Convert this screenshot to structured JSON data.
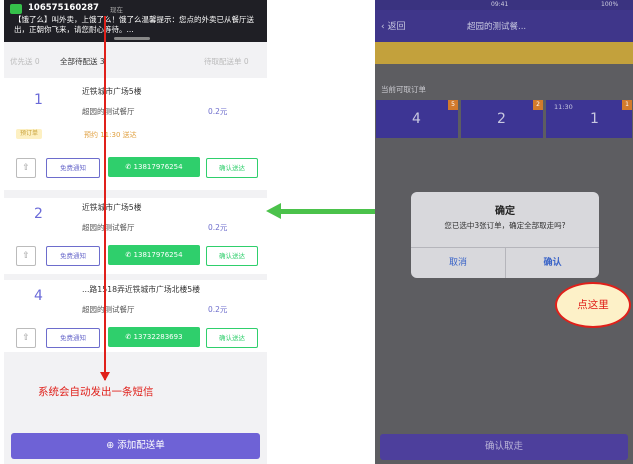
{
  "left": {
    "sms": {
      "sender": "106575160287",
      "time": "现在",
      "body": "【饿了么】叫外卖，上饿了么！饿了么温馨提示：您点的外卖已从餐厅送出，正朝你飞来，请您耐心等待。..."
    },
    "tabs": [
      "优先送 0",
      "全部待配送 3",
      "待取配送单 0"
    ],
    "orders": [
      {
        "num": "1",
        "address": "近铁城市广场5楼",
        "restaurant": "超园的测试餐厅",
        "price": "0.2元",
        "tag": "预订单",
        "eta": "预约 11:30 送达",
        "phone": "13817976254",
        "notify": "免费通知",
        "confirm": "确认送达"
      },
      {
        "num": "2",
        "address": "近铁城市广场5楼",
        "restaurant": "超园的测试餐厅",
        "price": "0.2元",
        "phone": "13817976254",
        "notify": "免费通知",
        "confirm": "确认送达"
      },
      {
        "num": "4",
        "address": "...路1518弄近铁城市广场北楼5楼",
        "restaurant": "超园的测试餐厅",
        "price": "0.2元",
        "phone": "13732283693",
        "notify": "免费通知",
        "confirm": "确认送达"
      }
    ],
    "sms_note": "系统会自动发出一条短信",
    "add_button": "添加配送单"
  },
  "right": {
    "status_time": "09:41",
    "battery": "100%",
    "nav": {
      "back": "返回",
      "title": "超园的测试餐..."
    },
    "section_label": "当前可取订单",
    "cards": [
      {
        "num": "4",
        "badge": "5",
        "time": ""
      },
      {
        "num": "2",
        "badge": "2",
        "time": ""
      },
      {
        "num": "1",
        "badge": "1",
        "time": "11:30"
      }
    ],
    "dialog": {
      "title": "确定",
      "message": "您已选中3张订单，确定全部取走吗?",
      "cancel": "取消",
      "confirm": "确认"
    },
    "callout": "点这里",
    "bottom_button": "确认取走"
  },
  "colors": {
    "accent": "#6e62d6",
    "green": "#2fcf6c",
    "red": "#e0201a"
  }
}
